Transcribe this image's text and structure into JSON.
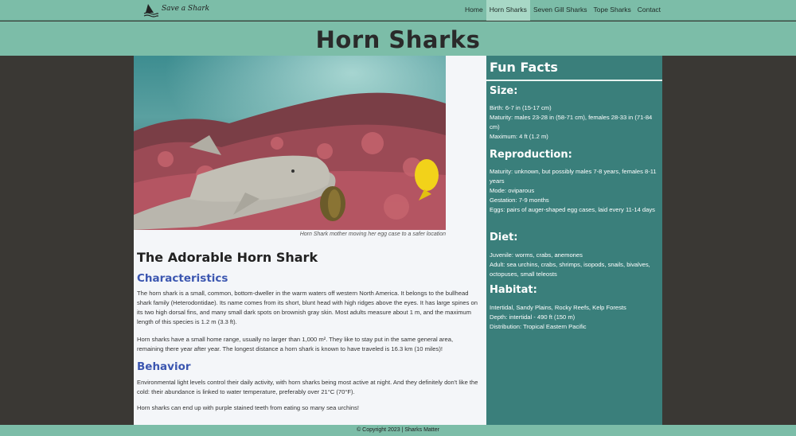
{
  "nav": {
    "site_name": "Save a Shark",
    "links": [
      "Home",
      "Horn Sharks",
      "Seven Gill Sharks",
      "Tope Sharks",
      "Contact"
    ],
    "active": "Horn Sharks"
  },
  "banner": {
    "title": "Horn Sharks"
  },
  "main": {
    "caption": "Horn Shark mother moving her egg case to a safer location",
    "heading": "The Adorable Horn Shark",
    "characteristics_heading": "Characteristics",
    "characteristics_p1": "The horn shark is a small, common, bottom-dweller in the warm waters off western North America. It belongs to the bullhead shark family (Heterodontidae). Its name comes from its short, blunt head with high ridges above the eyes. It has large spines on its two high dorsal fins, and many small dark spots on brownish gray skin. Most adults measure about 1 m, and the maximum length of this species is 1.2 m (3.3 ft).",
    "characteristics_p2": "Horn sharks have a small home range, usually no larger than 1,000 m². They like to stay put in the same general area, remaining there year after year. The longest distance a horn shark is known to have traveled is 16.3 km (10 miles)!",
    "behavior_heading": "Behavior",
    "behavior_p1": "Environmental light levels control their daily activity, with horn sharks being most active at night. And they definitely don't like the cold: their abundance is linked to water temperature, preferably over 21°C (70°F).",
    "behavior_p2": "Horn sharks can end up with purple stained teeth from eating so many sea urchins!"
  },
  "sidebar": {
    "title": "Fun Facts",
    "size": {
      "heading": "Size:",
      "lines": [
        "Birth: 6-7 in (15-17 cm)",
        "Maturity: males 23-28 in (58-71 cm), females 28-33 in (71-84 cm)",
        "Maximum: 4 ft (1.2 m)"
      ]
    },
    "reproduction": {
      "heading": "Reproduction:",
      "lines": [
        "Maturity: unknown, but possibly males 7-8 years, females 8-11 years",
        "Mode: oviparous",
        "Gestation: 7-9 months",
        "Eggs: pairs of auger-shaped egg cases, laid every 11-14 days"
      ]
    },
    "diet": {
      "heading": "Diet:",
      "lines": [
        "Juvenile: worms, crabs, anemones",
        "Adult: sea urchins, crabs, shrimps, isopods, snails, bivalves, octopuses, small teleosts"
      ]
    },
    "habitat": {
      "heading": "Habitat:",
      "lines": [
        "Intertidal, Sandy Plains, Rocky Reefs, Kelp Forests",
        "Depth: intertidal - 490 ft (150 m)",
        "Distribution: Tropical Eastern Pacific"
      ]
    }
  },
  "footer": {
    "text": "© Copyright 2023 | Sharks Matter"
  },
  "colors": {
    "nav_bg": "#7cbda8",
    "sidebar_bg": "#3a7f7b",
    "heading_blue": "#3b56b0",
    "page_bg": "#3a3834"
  },
  "icons": {
    "logo": "shark-fin-icon"
  }
}
